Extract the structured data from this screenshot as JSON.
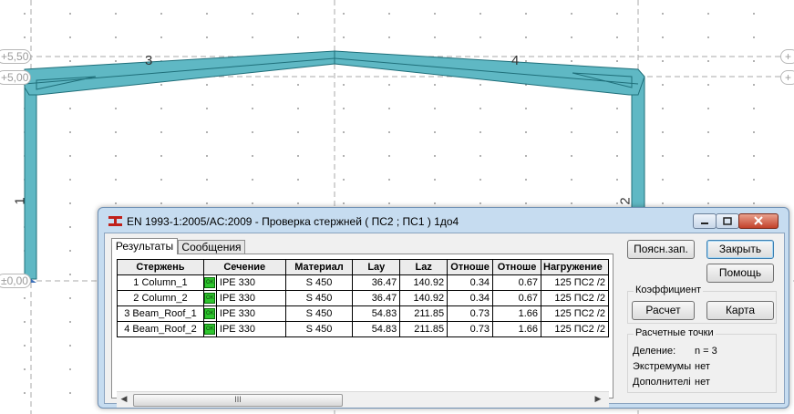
{
  "viewport": {
    "level_labels": {
      "roof_top": "+5,50",
      "eave": "+5,00",
      "base": "±0,00"
    },
    "member_numbers": [
      "1",
      "2",
      "3",
      "4"
    ]
  },
  "colors": {
    "member_fill": "#5fb8c4",
    "member_stroke": "#1f6f7a",
    "dialog_frame": "#c6dcf0",
    "ok_green": "#2ec52e"
  },
  "dialog": {
    "title": "EN 1993-1:2005/AC:2009 - Проверка стержней ( ПС2 ; ПС1 ) 1до4",
    "tabs": [
      "Результаты",
      "Сообщения"
    ],
    "table": {
      "headers": [
        "Стержень",
        "Сечение",
        "Материал",
        "Lay",
        "Laz",
        "Отноше",
        "Отноше",
        "Нагружение"
      ],
      "rows": [
        {
          "member": "1  Column_1",
          "status": "OK",
          "section": "IPE 330",
          "material": "S 450",
          "lay": "36.47",
          "laz": "140.92",
          "ratio1": "0.34",
          "ratio2": "0.67",
          "load": "125 ПС2 /2"
        },
        {
          "member": "2  Column_2",
          "status": "OK",
          "section": "IPE 330",
          "material": "S 450",
          "lay": "36.47",
          "laz": "140.92",
          "ratio1": "0.34",
          "ratio2": "0.67",
          "load": "125 ПС2 /2"
        },
        {
          "member": "3  Beam_Roof_1",
          "status": "OK",
          "section": "IPE 330",
          "material": "S 450",
          "lay": "54.83",
          "laz": "211.85",
          "ratio1": "0.73",
          "ratio2": "1.66",
          "load": "125 ПС2 /2"
        },
        {
          "member": "4  Beam_Roof_2",
          "status": "OK",
          "section": "IPE 330",
          "material": "S 450",
          "lay": "54.83",
          "laz": "211.85",
          "ratio1": "0.73",
          "ratio2": "1.66",
          "load": "125 ПС2 /2"
        }
      ],
      "scroll_thumb": "III"
    },
    "buttons": {
      "notes": "Поясн.зап.",
      "close": "Закрыть",
      "help": "Помощь",
      "calc": "Расчет",
      "map": "Карта"
    },
    "coefficient_group": {
      "title": "Коэффициент"
    },
    "calc_points": {
      "title": "Расчетные точки",
      "division_label": "Деление:",
      "division_value": "n = 3",
      "extremum_label": "Экстремумы",
      "extremum_value": "нет",
      "additional_label": "Дополнителі",
      "additional_value": "нет"
    }
  }
}
